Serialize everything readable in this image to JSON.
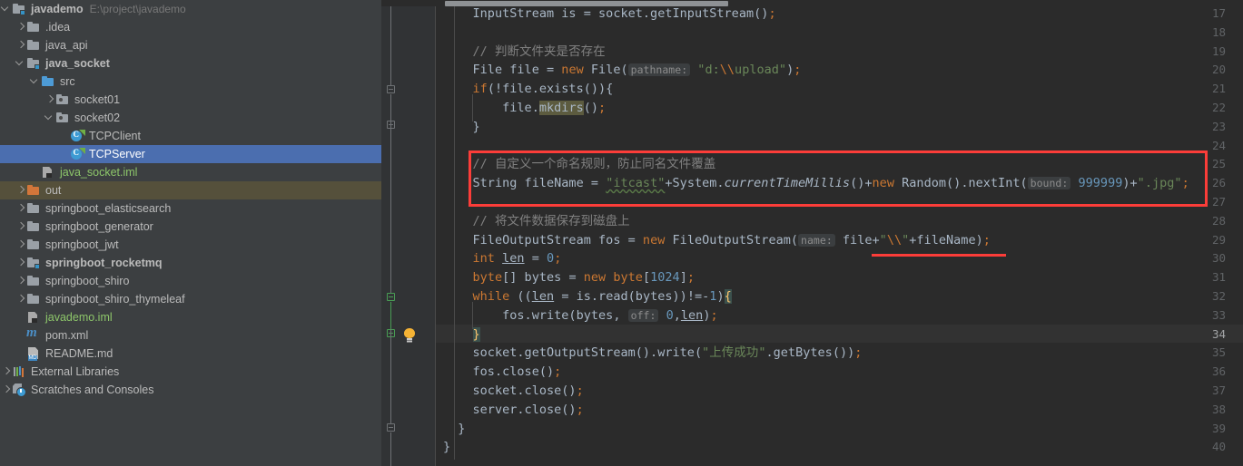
{
  "window": {
    "accent_selected": "#4B6EAF",
    "excluded_bg": "#55503B",
    "editor_bg": "#2B2B2B",
    "gutter_bg": "#313335",
    "sidebar_bg": "#3C3F41",
    "annotation_red": "#FC3D39"
  },
  "sidebar": {
    "name": "project-tree",
    "items": [
      {
        "label": "javademo",
        "path_hint": "E:\\project\\javademo",
        "icon": "module-icon",
        "indent": 0,
        "arrow": "down",
        "bold": true,
        "state": "normal"
      },
      {
        "label": ".idea",
        "path_hint": "",
        "icon": "folder-icon",
        "indent": 1,
        "arrow": "right",
        "bold": false,
        "state": "normal"
      },
      {
        "label": "java_api",
        "path_hint": "",
        "icon": "folder-icon",
        "indent": 1,
        "arrow": "right",
        "bold": false,
        "state": "normal"
      },
      {
        "label": "java_socket",
        "path_hint": "",
        "icon": "module-icon",
        "indent": 1,
        "arrow": "down",
        "bold": true,
        "state": "normal"
      },
      {
        "label": "src",
        "path_hint": "",
        "icon": "source-folder-icon",
        "indent": 2,
        "arrow": "down",
        "bold": false,
        "state": "normal"
      },
      {
        "label": "socket01",
        "path_hint": "",
        "icon": "package-icon",
        "indent": 3,
        "arrow": "right",
        "bold": false,
        "state": "normal"
      },
      {
        "label": "socket02",
        "path_hint": "",
        "icon": "package-icon",
        "indent": 3,
        "arrow": "down",
        "bold": false,
        "state": "normal"
      },
      {
        "label": "TCPClient",
        "path_hint": "",
        "icon": "java-class-icon",
        "indent": 4,
        "arrow": "none",
        "bold": false,
        "state": "normal"
      },
      {
        "label": "TCPServer",
        "path_hint": "",
        "icon": "java-class-icon",
        "indent": 4,
        "arrow": "none",
        "bold": false,
        "state": "selected"
      },
      {
        "label": "java_socket.iml",
        "path_hint": "",
        "icon": "iml-file-icon",
        "indent": 2,
        "arrow": "none",
        "bold": false,
        "state": "green"
      },
      {
        "label": "out",
        "path_hint": "",
        "icon": "excluded-folder-icon",
        "indent": 1,
        "arrow": "right",
        "bold": false,
        "state": "excluded"
      },
      {
        "label": "springboot_elasticsearch",
        "path_hint": "",
        "icon": "folder-icon",
        "indent": 1,
        "arrow": "right",
        "bold": false,
        "state": "normal"
      },
      {
        "label": "springboot_generator",
        "path_hint": "",
        "icon": "folder-icon",
        "indent": 1,
        "arrow": "right",
        "bold": false,
        "state": "normal"
      },
      {
        "label": "springboot_jwt",
        "path_hint": "",
        "icon": "folder-icon",
        "indent": 1,
        "arrow": "right",
        "bold": false,
        "state": "normal"
      },
      {
        "label": "springboot_rocketmq",
        "path_hint": "",
        "icon": "module-icon",
        "indent": 1,
        "arrow": "right",
        "bold": true,
        "state": "normal"
      },
      {
        "label": "springboot_shiro",
        "path_hint": "",
        "icon": "folder-icon",
        "indent": 1,
        "arrow": "right",
        "bold": false,
        "state": "normal"
      },
      {
        "label": "springboot_shiro_thymeleaf",
        "path_hint": "",
        "icon": "folder-icon",
        "indent": 1,
        "arrow": "right",
        "bold": false,
        "state": "normal"
      },
      {
        "label": "javademo.iml",
        "path_hint": "",
        "icon": "iml-file-icon",
        "indent": 1,
        "arrow": "none",
        "bold": false,
        "state": "green"
      },
      {
        "label": "pom.xml",
        "path_hint": "",
        "icon": "maven-icon",
        "indent": 1,
        "arrow": "none",
        "bold": false,
        "state": "normal"
      },
      {
        "label": "README.md",
        "path_hint": "",
        "icon": "markdown-icon",
        "indent": 1,
        "arrow": "none",
        "bold": false,
        "state": "normal"
      },
      {
        "label": "External Libraries",
        "path_hint": "",
        "icon": "libraries-icon",
        "indent": 0,
        "arrow": "right",
        "bold": false,
        "state": "normal"
      },
      {
        "label": "Scratches and Consoles",
        "path_hint": "",
        "icon": "scratches-icon",
        "indent": 0,
        "arrow": "right",
        "bold": false,
        "state": "normal"
      }
    ]
  },
  "editor": {
    "name": "code-editor",
    "language": "java",
    "first_visible_line": 17,
    "last_visible_line": 40,
    "caret_line": 34,
    "line_numbers": [
      17,
      18,
      19,
      20,
      21,
      22,
      23,
      24,
      25,
      26,
      27,
      28,
      29,
      30,
      31,
      32,
      33,
      34,
      35,
      36,
      37,
      38,
      39,
      40
    ],
    "lines": {
      "17": "            InputStream is = socket.getInputStream();",
      "18": "",
      "19": "            // 判断文件夹是否存在",
      "20": "            File file = new File( pathname: \"d:\\\\upload\");",
      "21": "            if(!file.exists()){",
      "22": "                file.mkdirs();",
      "23": "            }",
      "24": "",
      "25": "            // 自定义一个命名规则，防止同名文件覆盖",
      "26": "            String fileName = \"itcast\"+System.currentTimeMillis()+new Random().nextInt( bound: 999999)+\".jpg\";",
      "27": "",
      "28": "            // 将文件数据保存到磁盘上",
      "29": "            FileOutputStream fos = new FileOutputStream( name: file+\"\\\\\"+fileName);",
      "30": "            int len = 0;",
      "31": "            byte[] bytes = new byte[1024];",
      "32": "            while ((len = is.read(bytes))!=-1){",
      "33": "                fos.write(bytes, off: 0,len);",
      "34": "            }",
      "35": "            socket.getOutputStream().write(\"上传成功\".getBytes());",
      "36": "            fos.close();",
      "37": "            socket.close();",
      "38": "            server.close();",
      "39": "        }",
      "40": "    }"
    },
    "parameter_hints": [
      {
        "line": 20,
        "label": "pathname:"
      },
      {
        "line": 26,
        "label": "bound:"
      },
      {
        "line": 29,
        "label": "name:"
      },
      {
        "line": 33,
        "label": "off:"
      }
    ],
    "intention_bulb": {
      "line": 34,
      "icon": "lightbulb-icon",
      "color": "#F5B335"
    }
  },
  "annotations": {
    "red_box": {
      "name": "red-highlight-box",
      "covers_lines": "25-27",
      "color": "#FC3D39"
    },
    "red_underline": {
      "name": "red-underline",
      "covers": "file+\"\\\\\"+fileName",
      "line": 29,
      "color": "#FC3D39"
    }
  },
  "scrollbar": {
    "name": "horizontal-scrollbar",
    "orientation": "horizontal",
    "position_pct": 8
  }
}
